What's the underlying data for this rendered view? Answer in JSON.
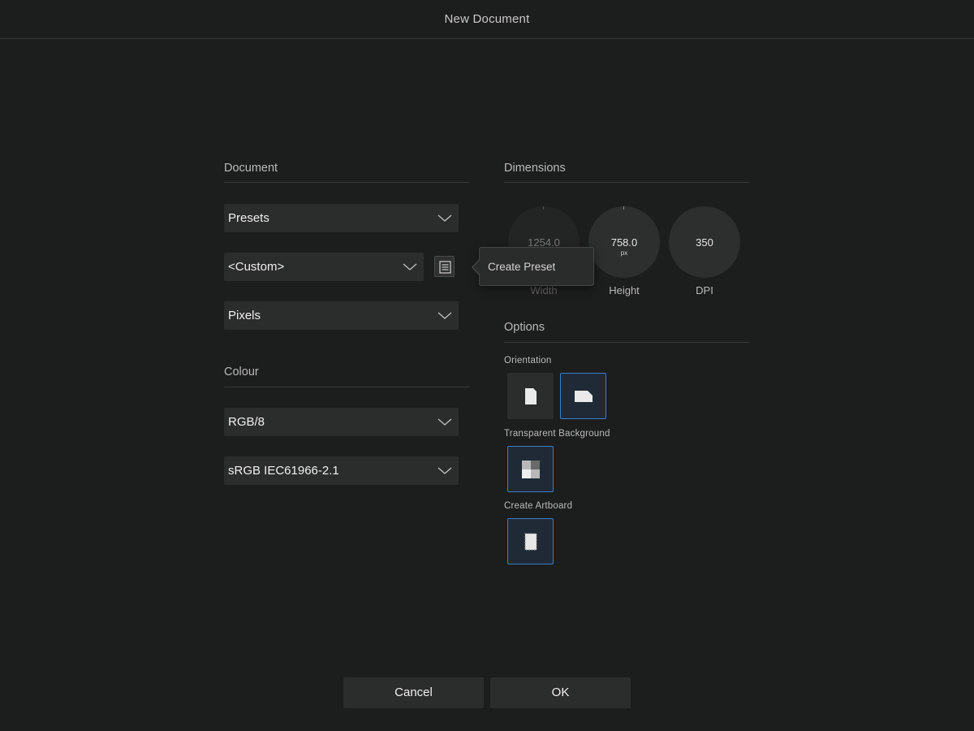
{
  "window": {
    "title": "New Document"
  },
  "document_section": {
    "title": "Document",
    "presets_label": "Presets",
    "custom_value": "<Custom>",
    "units_value": "Pixels",
    "preset_menu_icon": "list-icon",
    "tooltip": "Create Preset"
  },
  "colour_section": {
    "title": "Colour",
    "format_value": "RGB/8",
    "profile_value": "sRGB IEC61966-2.1"
  },
  "dimensions_section": {
    "title": "Dimensions",
    "width": {
      "value": "1254.0",
      "label": "Width"
    },
    "height": {
      "value": "758.0",
      "unit": "px",
      "label": "Height"
    },
    "dpi": {
      "value": "350",
      "label": "DPI"
    }
  },
  "options_section": {
    "title": "Options",
    "orientation_label": "Orientation",
    "orientation_selected": "landscape",
    "transparent_label": "Transparent Background",
    "transparent_on": true,
    "artboard_label": "Create Artboard",
    "artboard_on": true
  },
  "footer": {
    "cancel_label": "Cancel",
    "ok_label": "OK"
  },
  "colors": {
    "background": "#1c1d1d",
    "control": "#2b2c2c",
    "accent": "#3d7dc4"
  }
}
